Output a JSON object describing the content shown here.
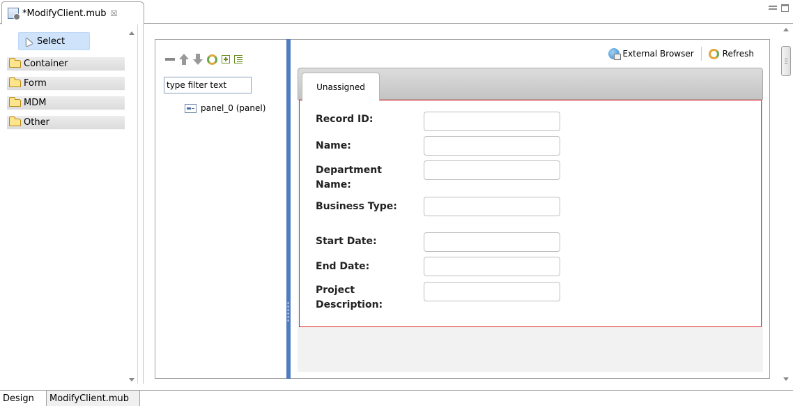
{
  "editor_tab": {
    "title": "*ModifyClient.mub",
    "close": "☒"
  },
  "palette": {
    "select_label": "Select",
    "drawers": [
      "Container",
      "Form",
      "MDM",
      "Other"
    ]
  },
  "outline": {
    "filter_placeholder": "type filter text",
    "tree_item": "panel_0 (panel)"
  },
  "preview": {
    "external_browser": "External Browser",
    "refresh": "Refresh",
    "tab": "Unassigned",
    "fields": [
      {
        "label": "Record ID:"
      },
      {
        "label": "Name:"
      },
      {
        "label": "Department Name:"
      },
      {
        "label": "Business Type:"
      },
      {
        "label": "Start Date:"
      },
      {
        "label": "End Date:"
      },
      {
        "label": "Project Description:"
      }
    ]
  },
  "bottom_tabs": [
    "Design",
    "ModifyClient.mub"
  ],
  "colors": {
    "selection": "#cfe4fb",
    "splitter": "#4f7bbf",
    "form_border": "#e02020"
  }
}
